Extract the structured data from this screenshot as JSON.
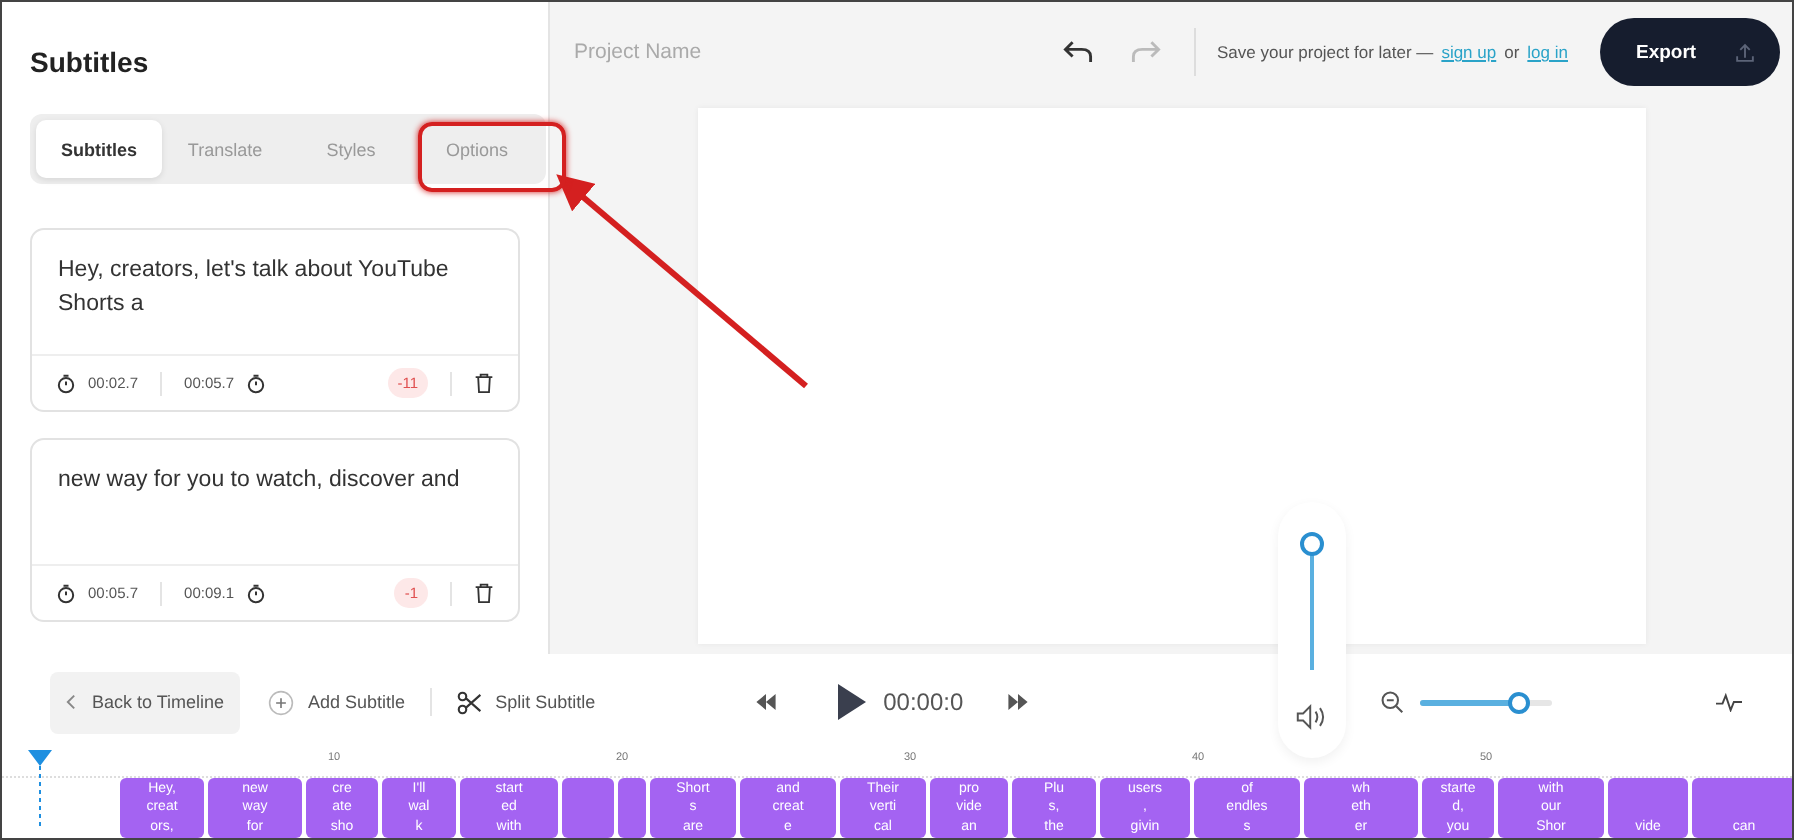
{
  "sidebar": {
    "title": "Subtitles",
    "tabs": [
      {
        "label": "Subtitles",
        "selected": true,
        "highlighted": false
      },
      {
        "label": "Translate",
        "selected": false,
        "highlighted": false
      },
      {
        "label": "Styles",
        "selected": false,
        "highlighted": false
      },
      {
        "label": "Options",
        "selected": false,
        "highlighted": true
      }
    ],
    "cards": [
      {
        "text": "Hey, creators, let's talk about YouTube Shorts a",
        "start": "00:02.7",
        "end": "00:05.7",
        "count": "-11"
      },
      {
        "text": "new way for you to watch, discover and",
        "start": "00:05.7",
        "end": "00:09.1",
        "count": "-1"
      }
    ]
  },
  "header": {
    "project_name": "Project Name",
    "undo_disabled": false,
    "redo_disabled": true,
    "save_text": "Save your project for later —",
    "sign_up": "sign up",
    "or": "or",
    "log_in": "log in",
    "export": "Export"
  },
  "volume": {
    "level": 0.9
  },
  "toolbar": {
    "back": "Back to Timeline",
    "add": "Add Subtitle",
    "split": "Split Subtitle",
    "time": "00:00:0",
    "zoom": {
      "level": 0.75
    }
  },
  "timeline": {
    "ticks": [
      "10",
      "20",
      "30",
      "40",
      "50"
    ],
    "clips": [
      {
        "lines": [
          "Hey,",
          "creat",
          "ors,"
        ]
      },
      {
        "lines": [
          "new",
          "way",
          "for"
        ]
      },
      {
        "lines": [
          "cre",
          "ate",
          "sho"
        ]
      },
      {
        "lines": [
          "I'll",
          "wal",
          "k"
        ]
      },
      {
        "lines": [
          "start",
          "ed",
          "with"
        ]
      },
      {
        "kind": "empty"
      },
      {
        "kind": "empty"
      },
      {
        "lines": [
          "Short",
          "s",
          "are"
        ]
      },
      {
        "lines": [
          "and",
          "creat",
          "e"
        ]
      },
      {
        "lines": [
          "Their",
          "verti",
          "cal"
        ]
      },
      {
        "lines": [
          "pro",
          "vide",
          "an"
        ]
      },
      {
        "lines": [
          "Plu",
          "s,",
          "the"
        ]
      },
      {
        "lines": [
          "users",
          ",",
          "givin"
        ]
      },
      {
        "lines": [
          "of",
          "endles",
          "s"
        ]
      },
      {
        "lines": [
          "wh",
          "eth",
          "er"
        ]
      },
      {
        "lines": [
          "starte",
          "d,",
          "you"
        ]
      },
      {
        "lines": [
          "with",
          "our",
          "Shor"
        ]
      },
      {
        "kind": "tail",
        "lines": [
          "vide"
        ]
      },
      {
        "kind": "tail",
        "lines": [
          "can"
        ]
      }
    ]
  }
}
